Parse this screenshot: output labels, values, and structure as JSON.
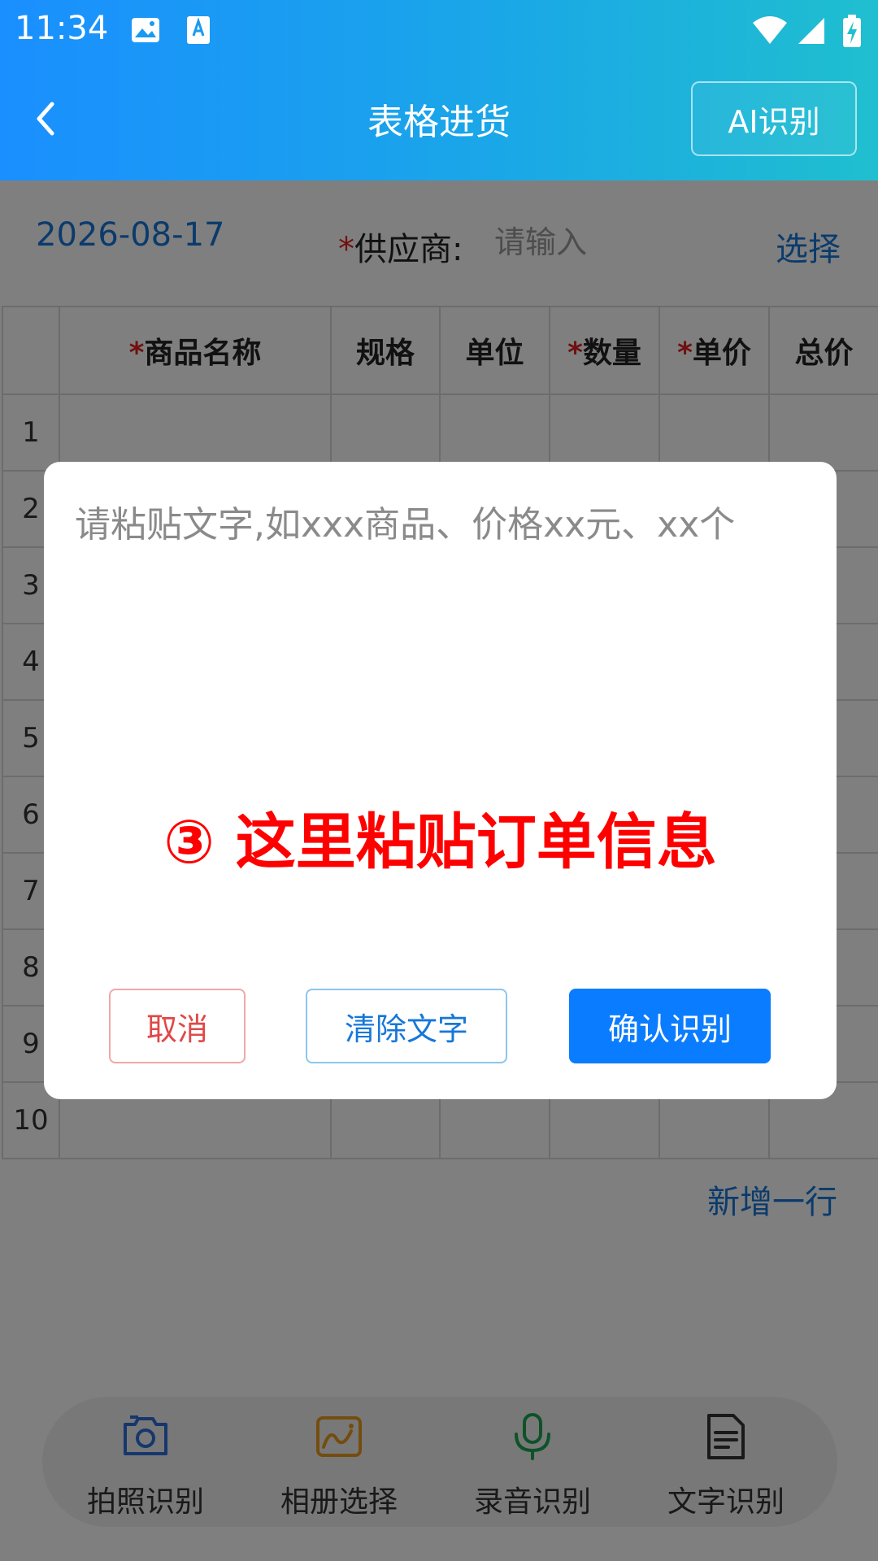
{
  "status_bar": {
    "time": "11:34"
  },
  "header": {
    "title": "表格进货",
    "ai_button": "AI识别"
  },
  "form": {
    "date": "2026-08-17",
    "required_mark": "*",
    "supplier_label": "供应商:",
    "supplier_placeholder": "请输入",
    "choose": "选择"
  },
  "table": {
    "columns": [
      {
        "label": "商品名称",
        "required": true
      },
      {
        "label": "规格",
        "required": false
      },
      {
        "label": "单位",
        "required": false
      },
      {
        "label": "数量",
        "required": true
      },
      {
        "label": "单价",
        "required": true
      },
      {
        "label": "总价",
        "required": false
      }
    ],
    "row_numbers": [
      "1",
      "2",
      "3",
      "4",
      "5",
      "6",
      "7",
      "8",
      "9",
      "10"
    ]
  },
  "add_row": "新增一行",
  "toolbar": {
    "items": [
      {
        "label": "拍照识别",
        "icon": "camera-icon",
        "color": "#2f6fd8"
      },
      {
        "label": "相册选择",
        "icon": "image-icon",
        "color": "#e89a1c"
      },
      {
        "label": "录音识别",
        "icon": "microphone-icon",
        "color": "#1aa550"
      },
      {
        "label": "文字识别",
        "icon": "document-icon",
        "color": "#333333"
      }
    ]
  },
  "dialog": {
    "textarea_placeholder": "请粘贴文字,如xxx商品、价格xx元、xx个",
    "textarea_value": "",
    "hint": "③ 这里粘贴订单信息",
    "cancel": "取消",
    "clear": "清除文字",
    "confirm": "确认识别"
  },
  "colors": {
    "primary": "#0a7cff",
    "link": "#1677d9",
    "required": "#e02020",
    "hint": "#ff0000"
  }
}
